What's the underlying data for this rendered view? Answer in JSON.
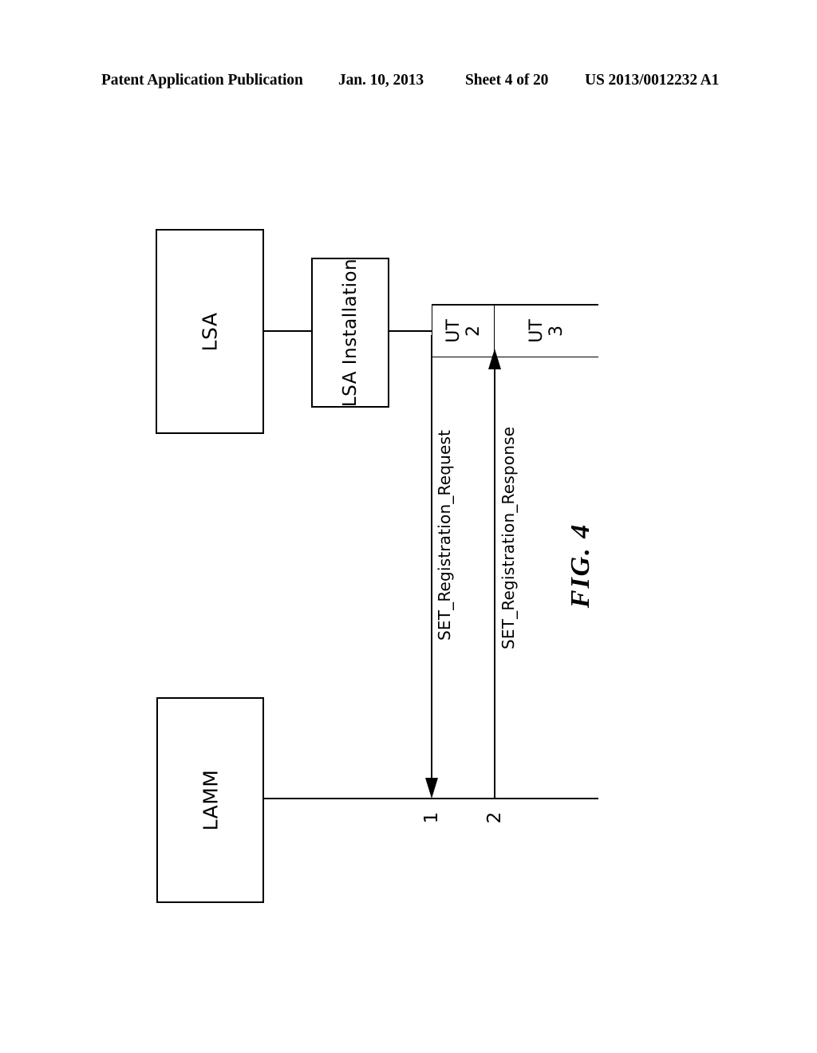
{
  "page_header": {
    "publication": "Patent Application Publication",
    "date": "Jan. 10, 2013",
    "sheet": "Sheet 4 of 20",
    "publication_number": "US 2013/0012232 A1"
  },
  "figure": {
    "caption": "FIG. 4",
    "orientation": "landscape-rotated-90",
    "nodes": [
      {
        "id": "lsa",
        "label": "LSA"
      },
      {
        "id": "lsa_installation",
        "label": "LSA Installation"
      },
      {
        "id": "lamm",
        "label": "LAMM"
      }
    ],
    "ut_cells": [
      {
        "id": "ut2",
        "line1": "UT",
        "line2": "2"
      },
      {
        "id": "ut3",
        "line1": "UT",
        "line2": "3"
      }
    ],
    "messages": [
      {
        "id": "msg1",
        "label": "SET_Registration_Request",
        "step": "1",
        "direction": "lsa-to-lamm"
      },
      {
        "id": "msg2",
        "label": "SET_Registration_Response",
        "step": "2",
        "direction": "lamm-to-lsa"
      }
    ]
  },
  "colors": {
    "ink": "#000000",
    "paper": "#ffffff"
  }
}
